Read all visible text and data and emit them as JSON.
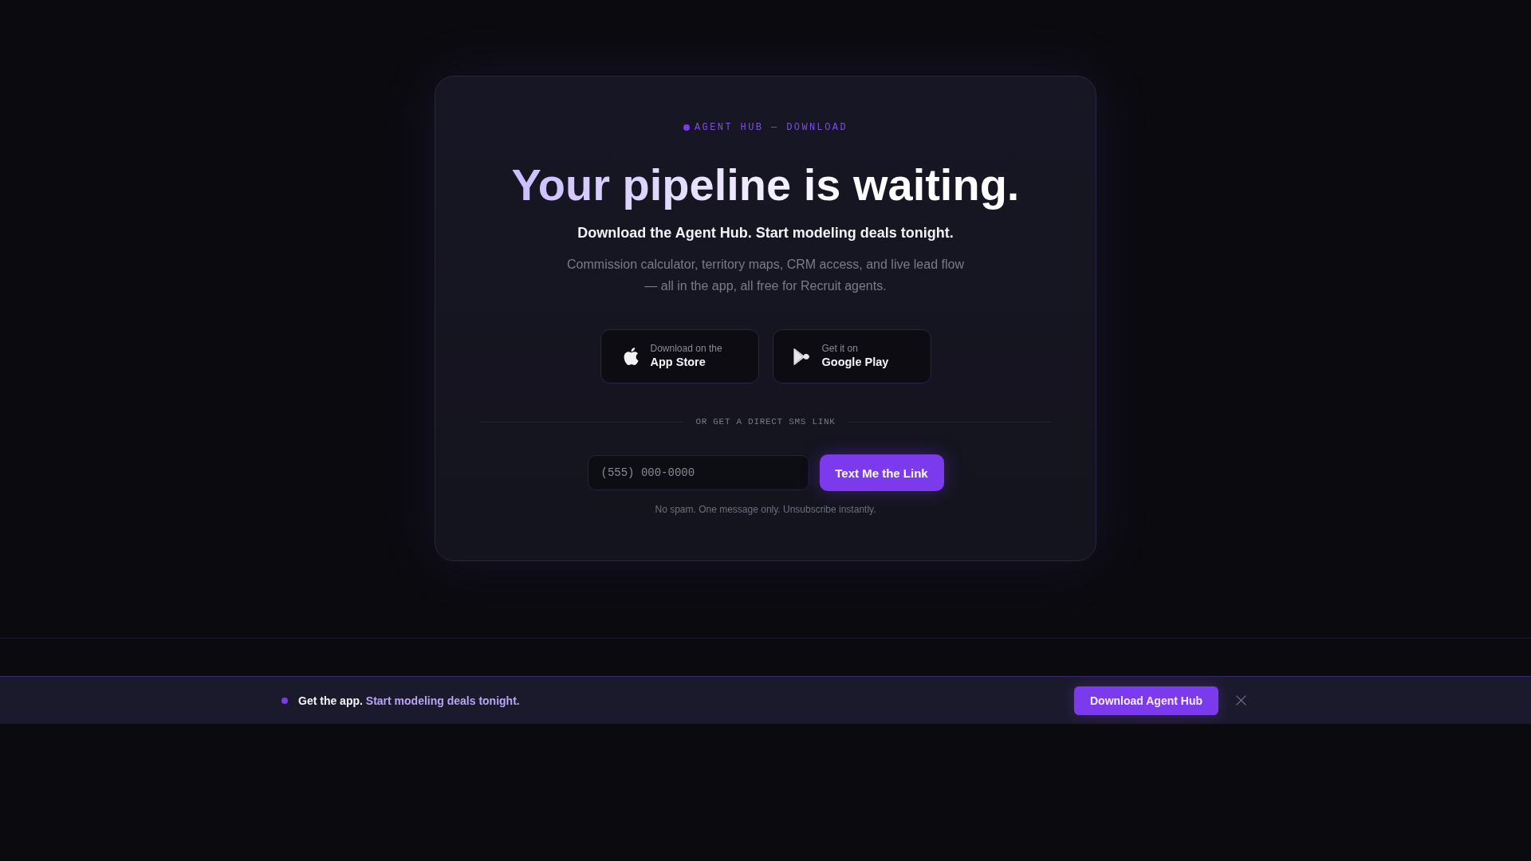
{
  "eyebrow": "AGENT HUB — DOWNLOAD",
  "headline": "Your pipeline is waiting.",
  "subheadline": "Download the Agent Hub. Start modeling deals tonight.",
  "description": "Commission calculator, territory maps, CRM access, and live lead flow — all in the app, all free for Recruit agents.",
  "store_buttons": [
    {
      "kind": "apple",
      "caption": "Download on the",
      "label": "App Store"
    },
    {
      "kind": "google_play",
      "caption": "Get it on",
      "label": "Google Play"
    }
  ],
  "divider_label": "OR GET A DIRECT SMS LINK",
  "sms_form": {
    "placeholder": "(555) 000-0000",
    "button": "Text Me the Link",
    "note": "No spam. One message only. Unsubscribe instantly."
  },
  "banner": {
    "lead": "Get the app.",
    "highlight": "Start modeling deals tonight.",
    "button": "Download Agent Hub"
  }
}
